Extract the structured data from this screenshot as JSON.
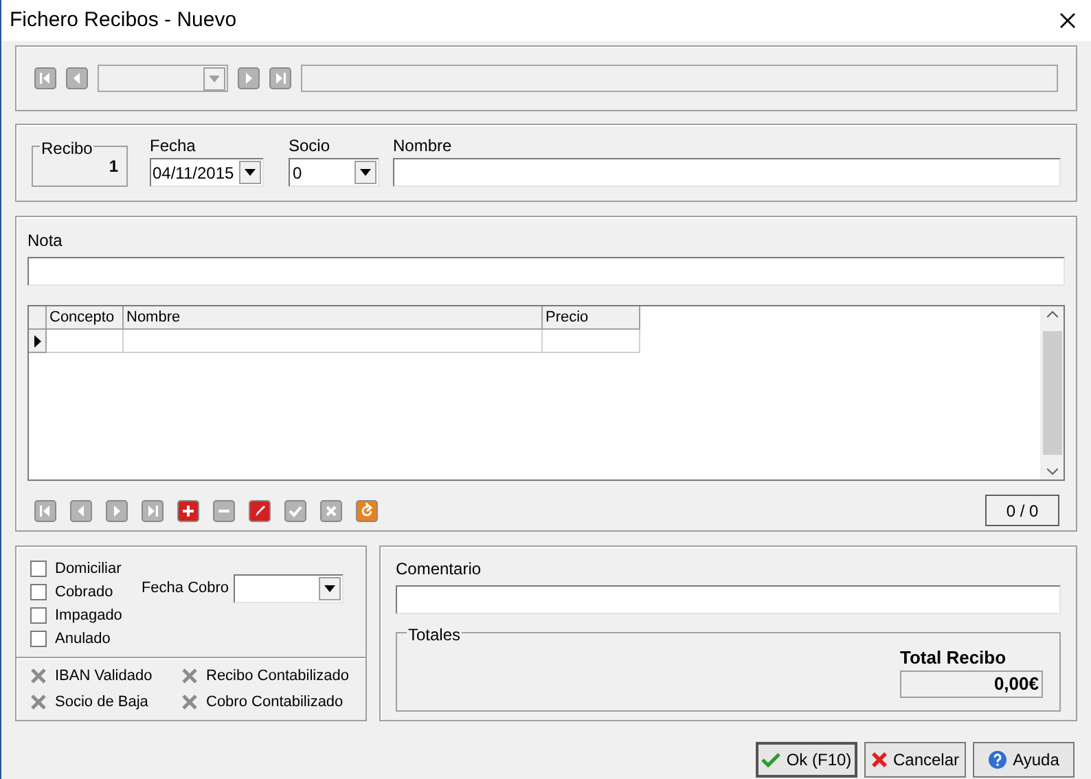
{
  "window": {
    "title": "Fichero Recibos - Nuevo"
  },
  "navigator": {
    "buttons": [
      {
        "kind": "first"
      },
      {
        "kind": "prior"
      },
      {
        "kind": "next"
      },
      {
        "kind": "last"
      }
    ]
  },
  "header": {
    "recibo_group": "Recibo",
    "recibo_value": "1",
    "fecha_label": "Fecha",
    "fecha_value": "04/11/2015",
    "socio_label": "Socio",
    "socio_value": "0",
    "nombre_label": "Nombre"
  },
  "nota_label": "Nota",
  "table": {
    "columns": [
      "Concepto",
      "Nombre",
      "Precio"
    ],
    "rows": [
      {
        "selected": true,
        "cells": [
          "",
          "",
          ""
        ]
      }
    ]
  },
  "grid_navigator": {
    "buttons": [
      {
        "kind": "first"
      },
      {
        "kind": "prior"
      },
      {
        "kind": "next"
      },
      {
        "kind": "last"
      },
      {
        "kind": "insert"
      },
      {
        "kind": "delete"
      },
      {
        "kind": "edit"
      },
      {
        "kind": "post"
      },
      {
        "kind": "cancel"
      },
      {
        "kind": "refresh"
      }
    ],
    "counter": "0 / 0"
  },
  "checkboxes": [
    {
      "label": "Domiciliar",
      "checked": false
    },
    {
      "label": "Cobrado",
      "checked": false
    },
    {
      "label": "Impagado",
      "checked": false
    },
    {
      "label": "Anulado",
      "checked": false
    }
  ],
  "fecha_cobro_label": "Fecha Cobro",
  "flags": [
    {
      "label": "IBAN Validado",
      "active": false
    },
    {
      "label": "Recibo Contabilizado",
      "active": false
    },
    {
      "label": "Socio de Baja",
      "active": false
    },
    {
      "label": "Cobro Contabilizado",
      "active": false
    }
  ],
  "comentario_label": "Comentario",
  "totales": {
    "group": "Totales",
    "label": "Total Recibo",
    "value": "0,00€"
  },
  "buttons": [
    {
      "kind": "ok",
      "label": "Ok (F10)"
    },
    {
      "kind": "cancel",
      "label": "Cancelar"
    },
    {
      "kind": "help",
      "label": "Ayuda"
    }
  ]
}
